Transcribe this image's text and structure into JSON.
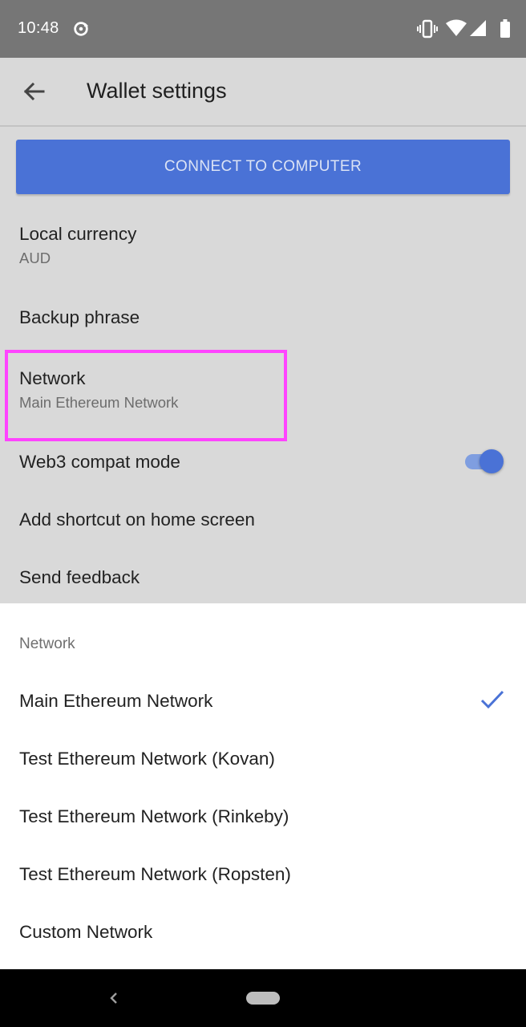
{
  "status_bar": {
    "time": "10:48",
    "icons": [
      "sync-icon",
      "vibrate-icon",
      "wifi-icon",
      "signal-icon",
      "battery-icon"
    ]
  },
  "app_bar": {
    "title": "Wallet settings",
    "back_icon": "arrow-back-icon"
  },
  "connect_button": {
    "label": "CONNECT TO COMPUTER"
  },
  "settings": {
    "local_currency": {
      "title": "Local currency",
      "value": "AUD"
    },
    "backup_phrase": {
      "title": "Backup phrase"
    },
    "network": {
      "title": "Network",
      "value": "Main Ethereum Network"
    },
    "web3_compat": {
      "title": "Web3 compat mode",
      "enabled": true
    },
    "add_shortcut": {
      "title": "Add shortcut on home screen"
    },
    "send_feedback": {
      "title": "Send feedback"
    }
  },
  "network_sheet": {
    "header": "Network",
    "options": [
      "Main Ethereum Network",
      "Test Ethereum Network (Kovan)",
      "Test Ethereum Network (Rinkeby)",
      "Test Ethereum Network (Ropsten)",
      "Custom Network"
    ],
    "selected_index": 0
  },
  "colors": {
    "accent": "#4a72d6",
    "highlight": "#ff44ff",
    "status_bar": "#767676"
  }
}
